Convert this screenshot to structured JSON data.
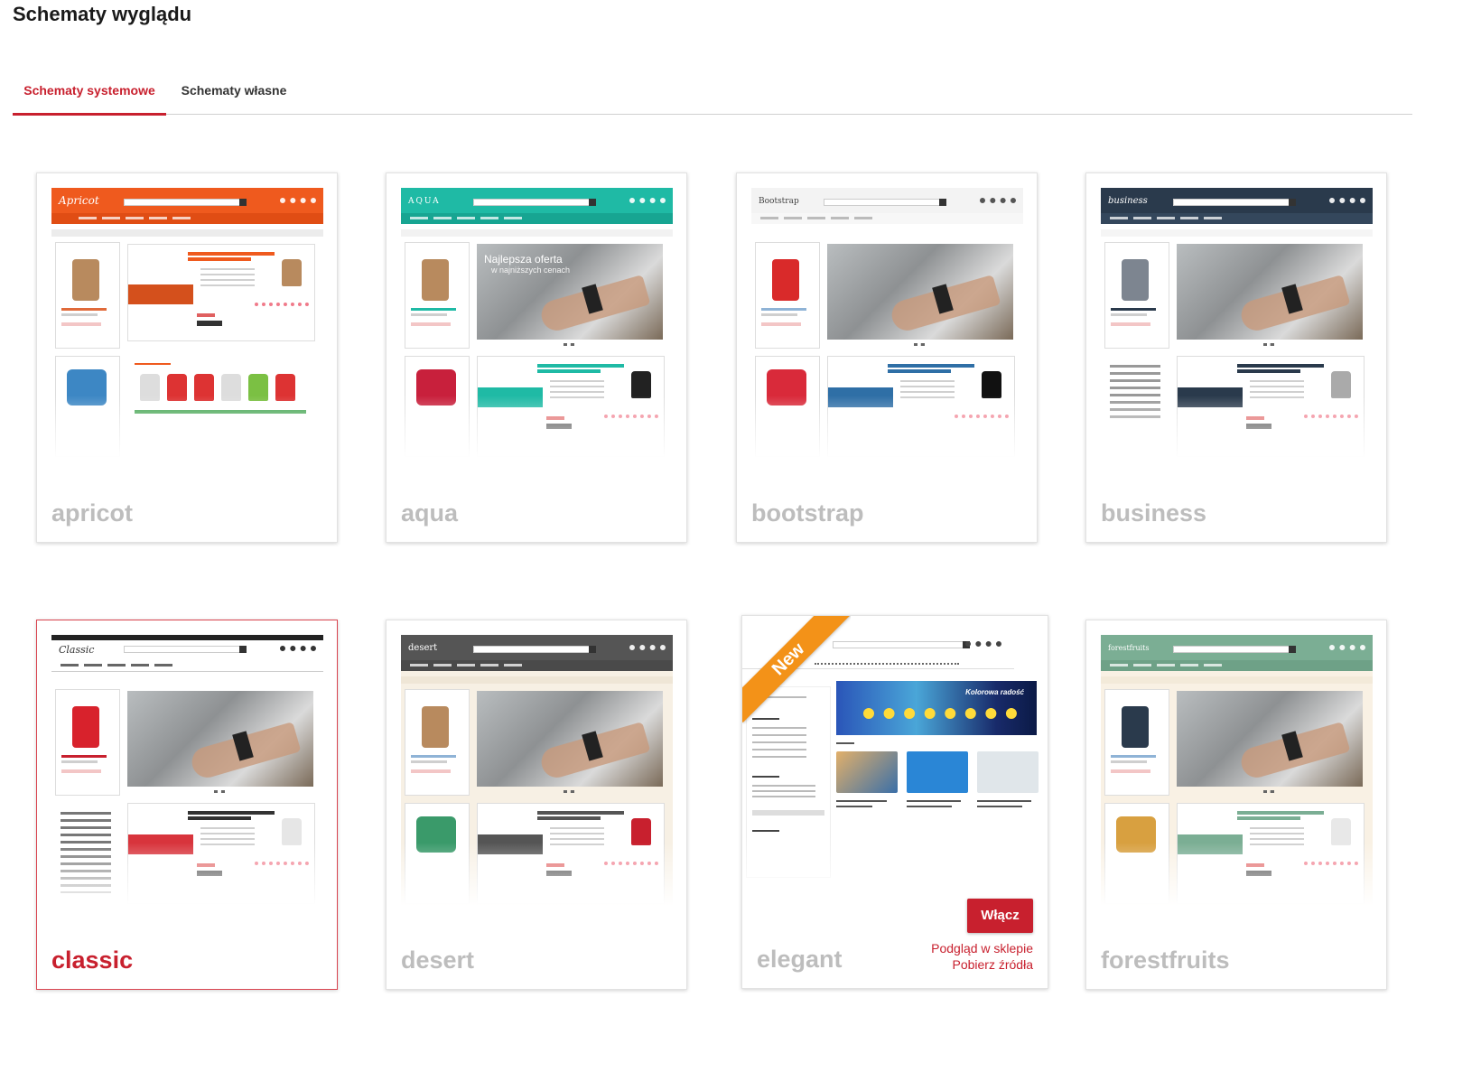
{
  "page": {
    "title": "Schematy wyglądu"
  },
  "tabs": [
    {
      "label": "Schematy systemowe",
      "active": true
    },
    {
      "label": "Schematy własne",
      "active": false
    }
  ],
  "themes": [
    {
      "name": "apricot",
      "header_color": "#ef5a1e",
      "selected": false
    },
    {
      "name": "aqua",
      "header_color": "#1fbaa5",
      "selected": false
    },
    {
      "name": "bootstrap",
      "header_color": "#f3f3f3",
      "selected": false
    },
    {
      "name": "business",
      "header_color": "#2a3a4c",
      "selected": false
    },
    {
      "name": "classic",
      "header_color": "#ffffff",
      "selected": true
    },
    {
      "name": "desert",
      "header_color": "#555555",
      "selected": false
    },
    {
      "name": "elegant",
      "header_color": "#ffffff",
      "selected": false,
      "badge": "New",
      "actions": {
        "enable": "Włącz",
        "preview": "Podgląd w sklepie",
        "download": "Pobierz źródła"
      }
    },
    {
      "name": "forestfruits",
      "header_color": "#7bae94",
      "selected": false
    }
  ],
  "thumbnails": {
    "apricot": {
      "logo": "Apricot"
    },
    "aqua": {
      "logo": "AQUA",
      "banner_line1": "Najlepsza oferta",
      "banner_line2": "w najniższych cenach"
    },
    "bootstrap": {
      "logo": "Bootstrap"
    },
    "business": {
      "logo": "business"
    },
    "classic": {
      "logo": "Classic"
    },
    "desert": {
      "logo": "desert"
    },
    "forestfruits": {
      "logo": "forestfruits"
    },
    "elegant": {
      "hero_text": "Kolorowa radość"
    }
  },
  "colors": {
    "accent": "#c8202e",
    "badge_orange": "#f39218",
    "theme_name_inactive": "#bdbdbd"
  }
}
